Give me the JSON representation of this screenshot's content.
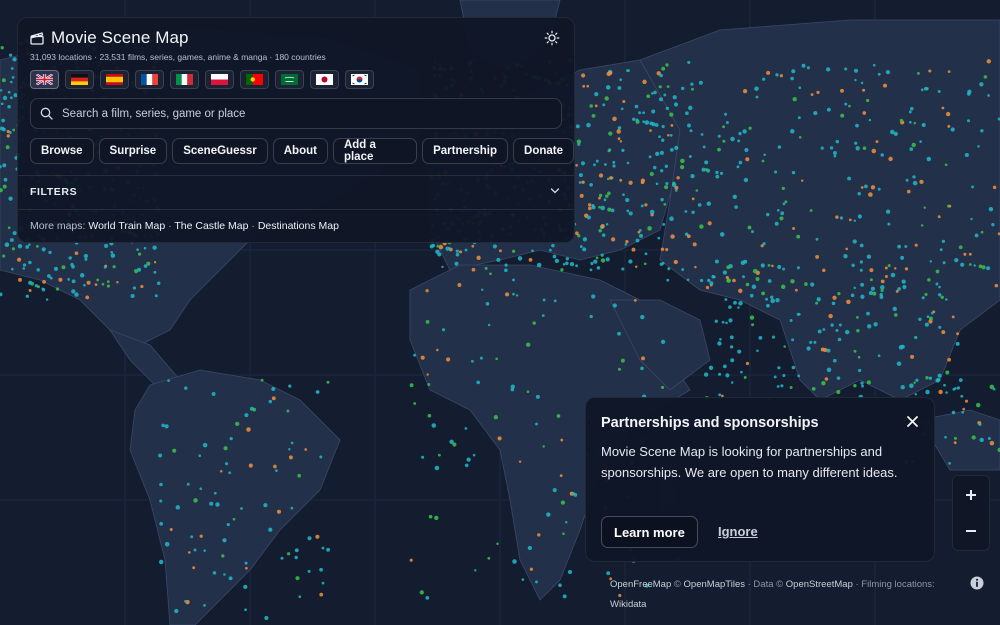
{
  "app": {
    "title": "Movie Scene Map",
    "subtitle": "31,093 locations · 23,531 films, series, games, anime & manga · 180 countries",
    "theme_icon": "sun-icon"
  },
  "languages": [
    {
      "name": "uk-flag",
      "active": true
    },
    {
      "name": "germany-flag",
      "active": false
    },
    {
      "name": "spain-flag",
      "active": false
    },
    {
      "name": "france-flag",
      "active": false
    },
    {
      "name": "italy-flag",
      "active": false
    },
    {
      "name": "poland-flag",
      "active": false
    },
    {
      "name": "portugal-flag",
      "active": false
    },
    {
      "name": "saudi-arabia-flag",
      "active": false
    },
    {
      "name": "japan-flag",
      "active": false
    },
    {
      "name": "south-korea-flag",
      "active": false
    }
  ],
  "search": {
    "placeholder": "Search a film, series, game or place",
    "value": ""
  },
  "nav": {
    "browse": "Browse",
    "surprise": "Surprise",
    "sceneguessr": "SceneGuessr",
    "about": "About",
    "add_place": "Add a place",
    "partnership": "Partnership",
    "donate": "Donate"
  },
  "filters": {
    "label": "FILTERS"
  },
  "more_maps": {
    "label": "More maps:",
    "links": [
      "World Train Map",
      "The Castle Map",
      "Destinations Map"
    ]
  },
  "popup": {
    "title": "Partnerships and sponsorships",
    "body": "Movie Scene Map is looking for partnerships and sponsorships. We are open to many different ideas.",
    "learn_more": "Learn more",
    "ignore": "Ignore"
  },
  "zoom": {
    "in": "+",
    "out": "−"
  },
  "attribution": {
    "openfreemap": "OpenFreeMap",
    "copy1": " © ",
    "openmaptiles": "OpenMapTiles",
    "data": " · Data © ",
    "osm": "OpenStreetMap",
    "filming": " · Filming locations: ",
    "wikidata": "Wikidata"
  },
  "colors": {
    "background": "#141d30",
    "land": "#23304a",
    "border": "#3a4866",
    "marker_cyan": "#20b8c8",
    "marker_green": "#3ac24a",
    "marker_orange": "#f0903a"
  }
}
